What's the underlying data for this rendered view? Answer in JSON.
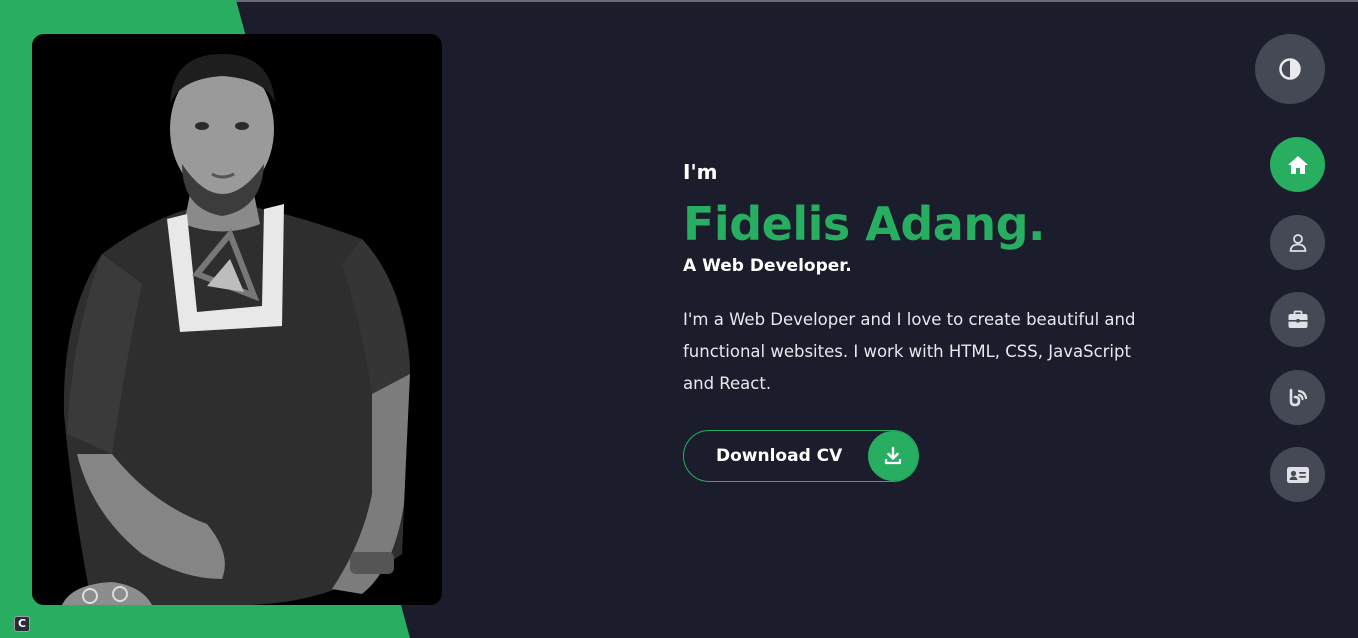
{
  "hero": {
    "greeting": "I'm",
    "name": "Fidelis Adang.",
    "role": "A Web Developer.",
    "bio": "I'm a Web Developer and I love to create beautiful and functional websites. I work with HTML, CSS, JavaScript and React."
  },
  "cta": {
    "label": "Download CV",
    "icon": "download-icon"
  },
  "photo": {
    "description_icon": "profile-photo"
  },
  "nav": {
    "theme_toggle_icon": "contrast-icon",
    "items": [
      {
        "icon": "home-icon",
        "active": true
      },
      {
        "icon": "user-icon",
        "active": false
      },
      {
        "icon": "briefcase-icon",
        "active": false
      },
      {
        "icon": "blog-icon",
        "active": false
      },
      {
        "icon": "contact-card-icon",
        "active": false
      }
    ]
  },
  "corner_badge": "C",
  "colors": {
    "background": "#1b1c2c",
    "accent": "#27ae60",
    "nav_button": "#444955"
  }
}
